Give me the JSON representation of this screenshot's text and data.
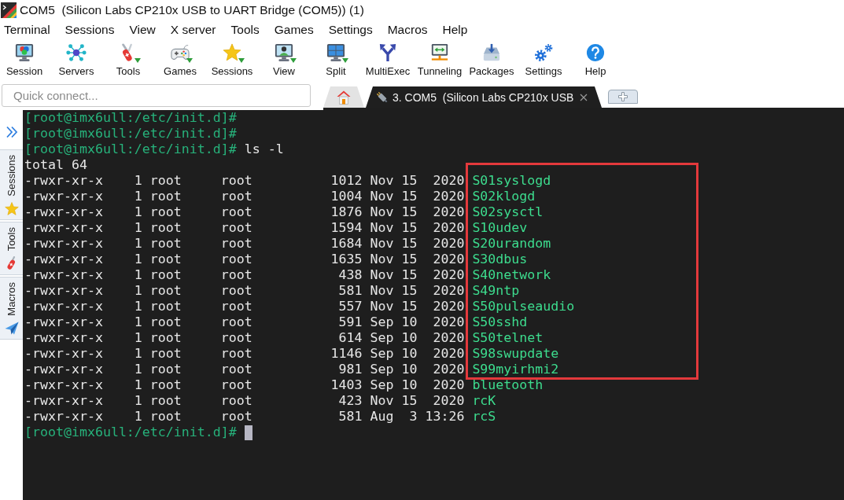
{
  "window": {
    "title": "COM5  (Silicon Labs CP210x USB to UART Bridge (COM5)) (1)"
  },
  "menu": [
    "Terminal",
    "Sessions",
    "View",
    "X server",
    "Tools",
    "Games",
    "Settings",
    "Macros",
    "Help"
  ],
  "toolbar": [
    {
      "label": "Session",
      "dropdown": false
    },
    {
      "label": "Servers",
      "dropdown": false
    },
    {
      "label": "Tools",
      "dropdown": true
    },
    {
      "label": "Games",
      "dropdown": true
    },
    {
      "label": "Sessions",
      "dropdown": true
    },
    {
      "label": "View",
      "dropdown": true
    },
    {
      "label": "Split",
      "dropdown": true
    },
    {
      "label": "MultiExec",
      "dropdown": false
    },
    {
      "label": "Tunneling",
      "dropdown": false
    },
    {
      "label": "Packages",
      "dropdown": false
    },
    {
      "label": "Settings",
      "dropdown": false
    },
    {
      "label": "Help",
      "dropdown": false
    }
  ],
  "quick_connect": {
    "placeholder": "Quick connect..."
  },
  "tabs": [
    {
      "kind": "home",
      "selected": false
    },
    {
      "kind": "session",
      "label": "3. COM5  (Silicon Labs CP210x USB",
      "selected": true
    }
  ],
  "sidebar": {
    "tabs": [
      {
        "label": "Sessions"
      },
      {
        "label": "Tools"
      },
      {
        "label": "Macros"
      }
    ]
  },
  "terminal": {
    "lines": [
      {
        "kind": "prompt",
        "prompt": "[root@imx6ull:/etc/init.d]#",
        "cursor": false
      },
      {
        "kind": "prompt",
        "prompt": "[root@imx6ull:/etc/init.d]#",
        "cursor": false
      },
      {
        "kind": "prompt",
        "prompt": "[root@imx6ull:/etc/init.d]#",
        "command": "ls -l",
        "cursor": false
      },
      {
        "kind": "output",
        "text": "total 64"
      },
      {
        "kind": "marked_group",
        "lines": [
          {
            "kind": "entry",
            "permissions": "-rwxr-xr-x",
            "links": "1",
            "owner": "root",
            "group": "root",
            "size": "1012",
            "month": "Nov",
            "day": "15",
            "time": "2020",
            "name": "S01syslogd"
          },
          {
            "kind": "entry",
            "permissions": "-rwxr-xr-x",
            "links": "1",
            "owner": "root",
            "group": "root",
            "size": "1004",
            "month": "Nov",
            "day": "15",
            "time": "2020",
            "name": "S02klogd"
          },
          {
            "kind": "entry",
            "permissions": "-rwxr-xr-x",
            "links": "1",
            "owner": "root",
            "group": "root",
            "size": "1876",
            "month": "Nov",
            "day": "15",
            "time": "2020",
            "name": "S02sysctl"
          },
          {
            "kind": "entry",
            "permissions": "-rwxr-xr-x",
            "links": "1",
            "owner": "root",
            "group": "root",
            "size": "1594",
            "month": "Nov",
            "day": "15",
            "time": "2020",
            "name": "S10udev"
          },
          {
            "kind": "entry",
            "permissions": "-rwxr-xr-x",
            "links": "1",
            "owner": "root",
            "group": "root",
            "size": "1684",
            "month": "Nov",
            "day": "15",
            "time": "2020",
            "name": "S20urandom"
          },
          {
            "kind": "entry",
            "permissions": "-rwxr-xr-x",
            "links": "1",
            "owner": "root",
            "group": "root",
            "size": "1635",
            "month": "Nov",
            "day": "15",
            "time": "2020",
            "name": "S30dbus"
          },
          {
            "kind": "entry",
            "permissions": "-rwxr-xr-x",
            "links": "1",
            "owner": "root",
            "group": "root",
            "size": "438",
            "month": "Nov",
            "day": "15",
            "time": "2020",
            "name": "S40network"
          },
          {
            "kind": "entry",
            "permissions": "-rwxr-xr-x",
            "links": "1",
            "owner": "root",
            "group": "root",
            "size": "581",
            "month": "Nov",
            "day": "15",
            "time": "2020",
            "name": "S49ntp"
          },
          {
            "kind": "entry",
            "permissions": "-rwxr-xr-x",
            "links": "1",
            "owner": "root",
            "group": "root",
            "size": "557",
            "month": "Nov",
            "day": "15",
            "time": "2020",
            "name": "S50pulseaudio"
          },
          {
            "kind": "entry",
            "permissions": "-rwxr-xr-x",
            "links": "1",
            "owner": "root",
            "group": "root",
            "size": "591",
            "month": "Sep",
            "day": "10",
            "time": "2020",
            "name": "S50sshd"
          },
          {
            "kind": "entry",
            "permissions": "-rwxr-xr-x",
            "links": "1",
            "owner": "root",
            "group": "root",
            "size": "614",
            "month": "Sep",
            "day": "10",
            "time": "2020",
            "name": "S50telnet"
          },
          {
            "kind": "entry",
            "permissions": "-rwxr-xr-x",
            "links": "1",
            "owner": "root",
            "group": "root",
            "size": "1146",
            "month": "Sep",
            "day": "10",
            "time": "2020",
            "name": "S98swupdate"
          },
          {
            "kind": "entry",
            "permissions": "-rwxr-xr-x",
            "links": "1",
            "owner": "root",
            "group": "root",
            "size": "981",
            "month": "Sep",
            "day": "10",
            "time": "2020",
            "name": "S99myirhmi2"
          }
        ]
      },
      {
        "kind": "entry",
        "permissions": "-rwxr-xr-x",
        "links": "1",
        "owner": "root",
        "group": "root",
        "size": "1403",
        "month": "Sep",
        "day": "10",
        "time": "2020",
        "name": "bluetooth"
      },
      {
        "kind": "entry",
        "permissions": "-rwxr-xr-x",
        "links": "1",
        "owner": "root",
        "group": "root",
        "size": "423",
        "month": "Nov",
        "day": "15",
        "time": "2020",
        "name": "rcK"
      },
      {
        "kind": "entry",
        "permissions": "-rwxr-xr-x",
        "links": "1",
        "owner": "root",
        "group": "root",
        "size": "581",
        "month": "Aug",
        "day": "3",
        "time": "13:26",
        "name": "rcS"
      },
      {
        "kind": "prompt",
        "prompt": "[root@imx6ull:/etc/init.d]#",
        "cursor": true
      }
    ]
  }
}
